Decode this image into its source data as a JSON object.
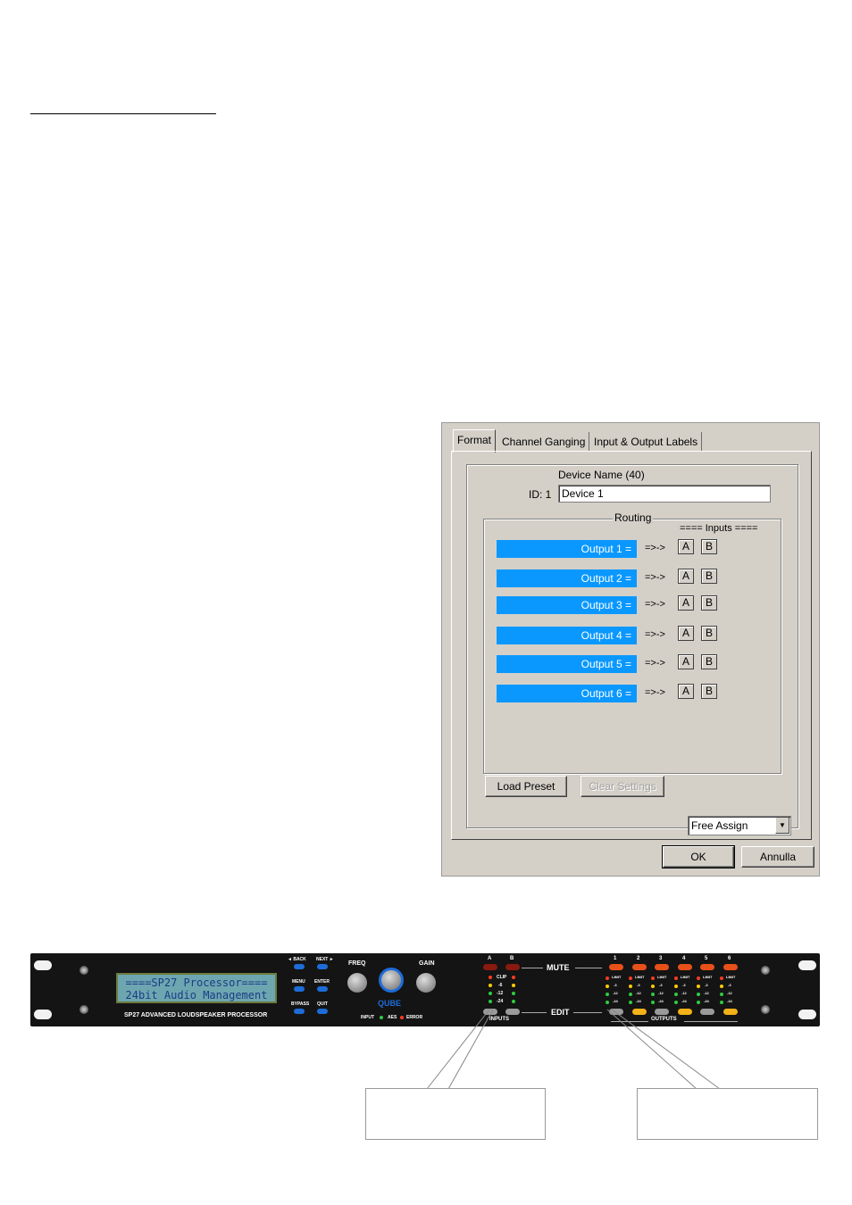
{
  "dialog": {
    "tabs": [
      "Format",
      "Channel Ganging",
      "Input & Output Labels"
    ],
    "device_name_label": "Device Name (40)",
    "id_label": "ID: 1",
    "device_name_value": "Device 1",
    "routing_label": "Routing",
    "inputs_header": "==== Inputs ====",
    "outputs": [
      {
        "label": "Output 1 =",
        "arrow": "=>->",
        "a": "A",
        "b": "B"
      },
      {
        "label": "Output 2 =",
        "arrow": "=>->",
        "a": "A",
        "b": "B"
      },
      {
        "label": "Output 3 =",
        "arrow": "=>->",
        "a": "A",
        "b": "B"
      },
      {
        "label": "Output 4 =",
        "arrow": "=>->",
        "a": "A",
        "b": "B"
      },
      {
        "label": "Output 5 =",
        "arrow": "=>->",
        "a": "A",
        "b": "B"
      },
      {
        "label": "Output 6 =",
        "arrow": "=>->",
        "a": "A",
        "b": "B"
      }
    ],
    "load_preset": "Load Preset",
    "clear_settings": "Clear Settings",
    "preset_select_value": "Free Assign",
    "ok": "OK",
    "cancel": "Annulla",
    "output_bar_color": "#0a98ff"
  },
  "rack": {
    "lcd_line1": "====SP27 Processor====",
    "lcd_line2": "24bit Audio Management",
    "model_label": "SP27 ADVANCED LOUDSPEAKER PROCESSOR",
    "back": "◄ BACK",
    "next": "NEXT ►",
    "menu": "MENU",
    "enter": "ENTER",
    "bypass": "BYPASS",
    "quit": "QUIT",
    "freq": "FREQ",
    "gain": "GAIN",
    "logo": "QUBE",
    "status": [
      "INPUT",
      "AES",
      "ERROR"
    ],
    "input_channels": [
      "A",
      "B"
    ],
    "clip": "CLIP",
    "meter_levels": [
      "-6",
      "-12",
      "-24"
    ],
    "mute": "MUTE",
    "edit": "EDIT",
    "inputs": "INPUTS",
    "outputs": "OUTPUTS",
    "output_channels": [
      "1",
      "2",
      "3",
      "4",
      "5",
      "6"
    ],
    "limit": "LIMIT",
    "out_levels": [
      "-3",
      "-12",
      "-24"
    ]
  }
}
